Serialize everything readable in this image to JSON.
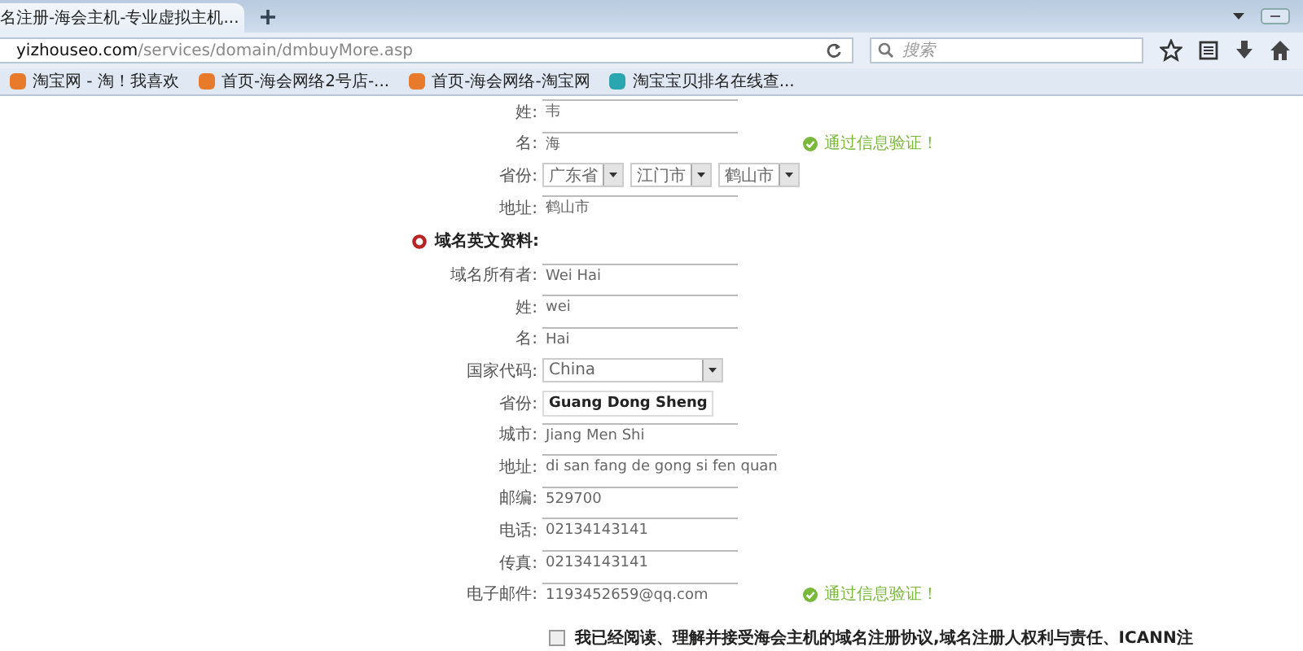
{
  "browser": {
    "tab_title": "名注册-海会主机-专业虚拟主机...",
    "url_domain": "yizhouseo.com",
    "url_path": "/services/domain/dmbuyMore.asp",
    "search": {
      "placeholder": "搜索"
    },
    "bookmarks": [
      {
        "label": "淘宝网 - 淘！我喜欢",
        "kind": "orange"
      },
      {
        "label": "首页-海会网络2号店-...",
        "kind": "orange"
      },
      {
        "label": "首页-海会网络-淘宝网",
        "kind": "orange"
      },
      {
        "label": "淘宝宝贝排名在线查...",
        "kind": "teal"
      }
    ]
  },
  "form": {
    "rows_cn": [
      {
        "label": "姓:",
        "kind": "text",
        "value": "韦"
      },
      {
        "label": "名:",
        "kind": "text",
        "value": "海",
        "note": "通过信息验证！"
      },
      {
        "label": "省份:",
        "kind": "selects",
        "options": [
          "广东省",
          "江门市",
          "鹤山市"
        ]
      },
      {
        "label": "地址:",
        "kind": "text",
        "value": "鹤山市"
      }
    ],
    "section": "域名英文资料:",
    "rows_en": [
      {
        "label": "域名所有者:",
        "kind": "text",
        "value": "Wei Hai"
      },
      {
        "label": "姓:",
        "kind": "text",
        "value": "wei"
      },
      {
        "label": "名:",
        "kind": "text",
        "value": "Hai"
      },
      {
        "label": "国家代码:",
        "kind": "select",
        "value": "China"
      },
      {
        "label": "省份:",
        "kind": "boxed",
        "value": "Guang Dong Sheng"
      },
      {
        "label": "城市:",
        "kind": "text",
        "value": "Jiang Men Shi"
      },
      {
        "label": "地址:",
        "kind": "text",
        "value": "di san fang de gong si fen quan"
      },
      {
        "label": "邮编:",
        "kind": "text",
        "value": "529700"
      },
      {
        "label": "电话:",
        "kind": "text",
        "value": "02134143141"
      },
      {
        "label": "传真:",
        "kind": "text",
        "value": "02134143141"
      },
      {
        "label": "电子邮件:",
        "kind": "text",
        "value": "1193452659@qq.com",
        "note": "通过信息验证！"
      }
    ],
    "agreement": {
      "checked": false,
      "text": "我已经阅读、理解并接受海会主机的域名注册协议,域名注册人权利与责任、ICANN注"
    }
  }
}
